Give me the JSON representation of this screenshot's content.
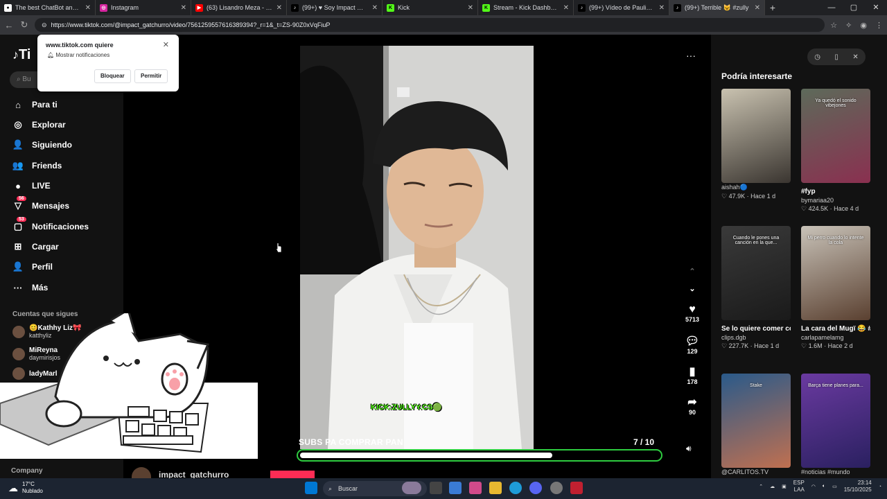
{
  "browser": {
    "tabs": [
      {
        "title": "The best ChatBot and Widg",
        "fav_color": "#ffffff",
        "fav_text": "●",
        "fav_icon": "chatbot-icon"
      },
      {
        "title": "Instagram",
        "fav_color": "#d6249f",
        "fav_text": "◎",
        "fav_icon": "instagram-icon"
      },
      {
        "title": "(63) Lisandro Meza - Sende",
        "fav_color": "#ff0000",
        "fav_text": "▶",
        "fav_icon": "youtube-icon"
      },
      {
        "title": "(99+) ♥ Soy Impact 😊 (@",
        "fav_color": "#000000",
        "fav_text": "♪",
        "fav_icon": "tiktok-icon"
      },
      {
        "title": "Kick",
        "fav_color": "#53fc18",
        "fav_text": "K",
        "fav_icon": "kick-icon"
      },
      {
        "title": "Stream - Kick Dashboard",
        "fav_color": "#53fc18",
        "fav_text": "K",
        "fav_icon": "kick-icon"
      },
      {
        "title": "(99+) Vídeo de Paulina Guz",
        "fav_color": "#000000",
        "fav_text": "♪",
        "fav_icon": "tiktok-icon"
      },
      {
        "title": "(99+) Terrible 😺 #zully",
        "fav_color": "#000000",
        "fav_text": "♪",
        "fav_icon": "tiktok-icon"
      }
    ],
    "url": "https://www.tiktok.com/@impact_gatchurro/video/7561259557616389394?_r=1&_t=ZS-90Z0xVqFiuP"
  },
  "popup": {
    "title": "www.tiktok.com quiere",
    "body": "Mostrar notificaciones",
    "block": "Bloquear",
    "allow": "Permitir"
  },
  "sidebar": {
    "logo": "Ti",
    "search_placeholder": "Bu",
    "items": [
      {
        "label": "Para ti",
        "icon": "⌂",
        "icon_name": "home-icon"
      },
      {
        "label": "Explorar",
        "icon": "◎",
        "icon_name": "compass-icon"
      },
      {
        "label": "Siguiendo",
        "icon": "👤",
        "icon_name": "following-icon"
      },
      {
        "label": "Friends",
        "icon": "👥",
        "icon_name": "friends-icon"
      },
      {
        "label": "LIVE",
        "icon": "●",
        "icon_name": "live-icon"
      },
      {
        "label": "Mensajes",
        "icon": "▽",
        "icon_name": "messages-icon",
        "badge": "56"
      },
      {
        "label": "Notificaciones",
        "icon": "▢",
        "icon_name": "notifications-icon",
        "badge": "53"
      },
      {
        "label": "Cargar",
        "icon": "⊞",
        "icon_name": "upload-icon"
      },
      {
        "label": "Perfil",
        "icon": "👤",
        "icon_name": "profile-icon"
      },
      {
        "label": "Más",
        "icon": "···",
        "icon_name": "more-icon"
      }
    ],
    "following_title": "Cuentas que sigues",
    "accounts": [
      {
        "name": "😊Kathhy Liz🎀",
        "handle": "katthyliz"
      },
      {
        "name": "MiReyna",
        "handle": "daymirisjos"
      },
      {
        "name": "ladyMarl",
        "handle": ""
      }
    ],
    "company": "Company"
  },
  "video": {
    "caption_overlay": "KICK:ZULLYY.CS🟢",
    "progress_label": "SUBS PA COMPRAR PAN",
    "progress_count": "7  / 10",
    "progress_fraction": 0.7,
    "likes": "5713",
    "comments": "129",
    "saves": "178",
    "shares": "90",
    "author": "impact_gatchurro"
  },
  "recommended": {
    "title": "Podría interesarte",
    "cards": [
      {
        "caption": "",
        "user": "aishah🔵",
        "likes": "47.9K",
        "age": "Hace 1 d",
        "colors": [
          "#c9c2b0",
          "#3a3530"
        ]
      },
      {
        "caption": "#fyp",
        "user": "bymariaa20",
        "likes": "424.5K",
        "age": "Hace 4 d",
        "colors": [
          "#5d6a5a",
          "#8a3050"
        ],
        "overlay": "Ya quedó el sonido vibejones"
      },
      {
        "caption": "Se lo quiere comer con la mirada 😍😍...",
        "user": "clips.dgb",
        "likes": "227.7K",
        "age": "Hace 1 d",
        "colors": [
          "#3a3a3a",
          "#1a1a1a"
        ],
        "overlay": "Cuando le pones una canción en la que..."
      },
      {
        "caption": "La cara del Mugï 😂 #cat #dog #tiktok...",
        "user": "carlapamelamg",
        "likes": "1.6M",
        "age": "Hace 2 d",
        "colors": [
          "#c8c2b8",
          "#5a4030"
        ],
        "overlay": "Mi perro cuando lo intente la cola"
      },
      {
        "caption": "",
        "user": "@CARLITOS.TV",
        "likes": "",
        "age": "",
        "colors": [
          "#2a5a8a",
          "#c07050"
        ],
        "overlay": "Stake"
      },
      {
        "caption": "",
        "user": "#noticias #mundo",
        "likes": "",
        "age": "",
        "colors": [
          "#6a3aa0",
          "#2a2060"
        ],
        "overlay": "Barça tiene planes para..."
      }
    ]
  },
  "taskbar": {
    "temp": "17°C",
    "weather": "Nublado",
    "search": "Buscar",
    "lang": "ESP",
    "lang2": "LAA",
    "time": "23:14",
    "date": "15/10/2025"
  }
}
